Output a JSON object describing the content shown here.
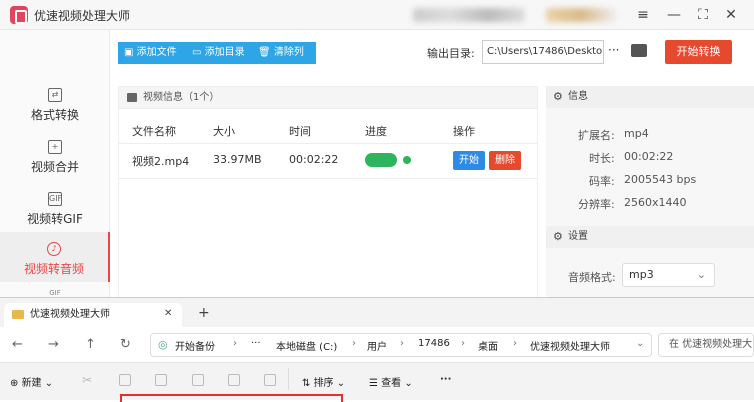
{
  "app": {
    "title": "优速视频处理大师"
  },
  "window": {
    "menu_icon": "≡",
    "min_icon": "—",
    "max_icon": "⛶",
    "close_icon": "✕"
  },
  "sidebar": {
    "items": [
      {
        "label": "格式转换",
        "icon": "⇄"
      },
      {
        "label": "视频合并",
        "icon": "+"
      },
      {
        "label": "视频转GIF",
        "icon": "GIF"
      },
      {
        "label": "视频转音频",
        "icon": "♪"
      },
      {
        "label": "GIF",
        "icon": ""
      }
    ]
  },
  "toolbar": {
    "add_file": "添加文件",
    "add_dir": "添加目录",
    "clear_list": "清除列表",
    "output_label": "输出目录:",
    "output_path": "C:\\Users\\17486\\Deskto",
    "more": "···",
    "start": "开始转换"
  },
  "video_panel": {
    "title": "视频信息（1个）",
    "columns": [
      "文件名称",
      "大小",
      "时间",
      "进度",
      "操作"
    ],
    "rows": [
      {
        "name": "视频2.mp4",
        "size": "33.97MB",
        "time": "00:02:22",
        "start": "开始",
        "delete": "删除"
      }
    ]
  },
  "info_panel": {
    "title": "信息",
    "fields": [
      {
        "label": "扩展名:",
        "value": "mp4"
      },
      {
        "label": "时长:",
        "value": "00:02:22"
      },
      {
        "label": "码率:",
        "value": "2005543 bps"
      },
      {
        "label": "分辨率:",
        "value": "2560x1440"
      }
    ]
  },
  "settings_panel": {
    "title": "设置",
    "format_label": "音频格式:",
    "format_value": "mp3"
  },
  "explorer": {
    "tab_title": "优速视频处理大师",
    "tab_close": "✕",
    "tab_new": "+",
    "breadcrumb": [
      "开始备份",
      "···",
      "本地磁盘 (C:)",
      "用户",
      "17486",
      "桌面",
      "优速视频处理大师"
    ],
    "search_placeholder": "在 优速视频处理大师",
    "toolbar": {
      "new": "新建",
      "sort": "排序",
      "view": "查看",
      "more": "···"
    }
  },
  "colors": {
    "accent_red": "#e64a2e",
    "accent_blue": "#2da5e6",
    "progress_green": "#2db55d"
  }
}
